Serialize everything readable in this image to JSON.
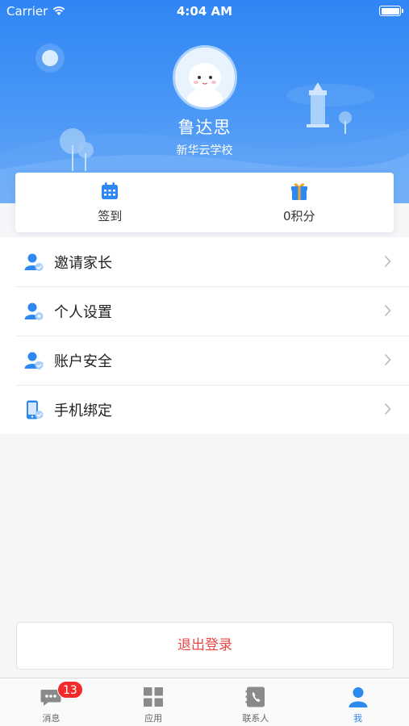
{
  "status_bar": {
    "carrier": "Carrier",
    "time": "4:04 AM"
  },
  "profile": {
    "name": "鲁达思",
    "school": "新华云学校"
  },
  "quick_actions": [
    {
      "label": "签到",
      "icon": "calendar-icon"
    },
    {
      "label": "0积分",
      "icon": "gift-icon"
    }
  ],
  "menu": [
    {
      "label": "邀请家长",
      "icon": "invite-parent-icon"
    },
    {
      "label": "个人设置",
      "icon": "user-settings-icon"
    },
    {
      "label": "账户安全",
      "icon": "account-security-icon"
    },
    {
      "label": "手机绑定",
      "icon": "phone-bind-icon"
    }
  ],
  "logout": {
    "label": "退出登录"
  },
  "tabs": [
    {
      "label": "消息",
      "icon": "message-icon",
      "badge": "13"
    },
    {
      "label": "应用",
      "icon": "apps-grid-icon"
    },
    {
      "label": "联系人",
      "icon": "contacts-icon"
    },
    {
      "label": "我",
      "icon": "person-icon",
      "active": true
    }
  ],
  "colors": {
    "primary": "#2d88f0",
    "danger": "#e94545",
    "badge": "#f12b2b"
  }
}
